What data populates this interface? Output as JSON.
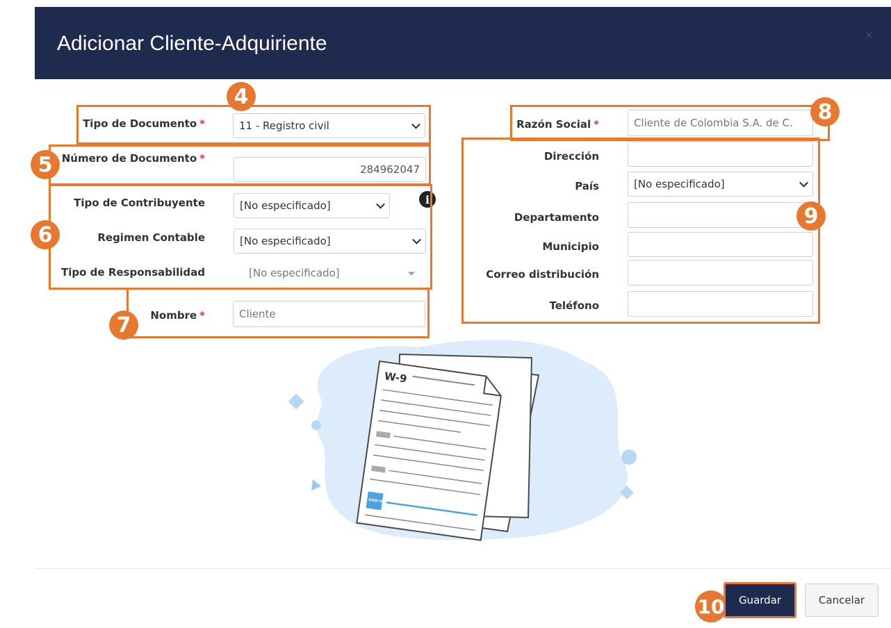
{
  "header": {
    "title": "Adicionar Cliente-Adquiriente",
    "close_label": "×"
  },
  "left_form": {
    "tipo_documento": {
      "label": "Tipo de Documento",
      "value": "11 - Registro civil"
    },
    "numero_documento": {
      "label": "Número de Documento",
      "value": "284962047"
    },
    "tipo_contribuyente": {
      "label": "Tipo de Contribuyente",
      "value": "[No especificado]"
    },
    "regimen_contable": {
      "label": "Regimen Contable",
      "value": "[No especificado]"
    },
    "tipo_responsabilidad": {
      "label": "Tipo de Responsabilidad",
      "value": "[No especificado]"
    },
    "nombre": {
      "label": "Nombre",
      "value": "Cliente"
    }
  },
  "right_form": {
    "razon_social": {
      "label": "Razón Social",
      "value": "Cliente de Colombia S.A. de C."
    },
    "direccion": {
      "label": "Dirección",
      "value": ""
    },
    "pais": {
      "label": "País",
      "value": "[No especificado]"
    },
    "departamento": {
      "label": "Departamento",
      "value": ""
    },
    "municipio": {
      "label": "Municipio",
      "value": ""
    },
    "correo": {
      "label": "Correo distribución",
      "value": ""
    },
    "telefono": {
      "label": "Teléfono",
      "value": ""
    }
  },
  "required_mark": "*",
  "info_icon_glyph": "i",
  "callouts": [
    "4",
    "5",
    "6",
    "7",
    "8",
    "9",
    "10"
  ],
  "illustration": {
    "form_code": "W-9",
    "sign_text": "SIGN HERE"
  },
  "footer": {
    "save_label": "Guardar",
    "cancel_label": "Cancelar"
  },
  "colors": {
    "header_bg": "#1f2a4f",
    "callout": "#e6782f",
    "required": "#d9393e"
  }
}
